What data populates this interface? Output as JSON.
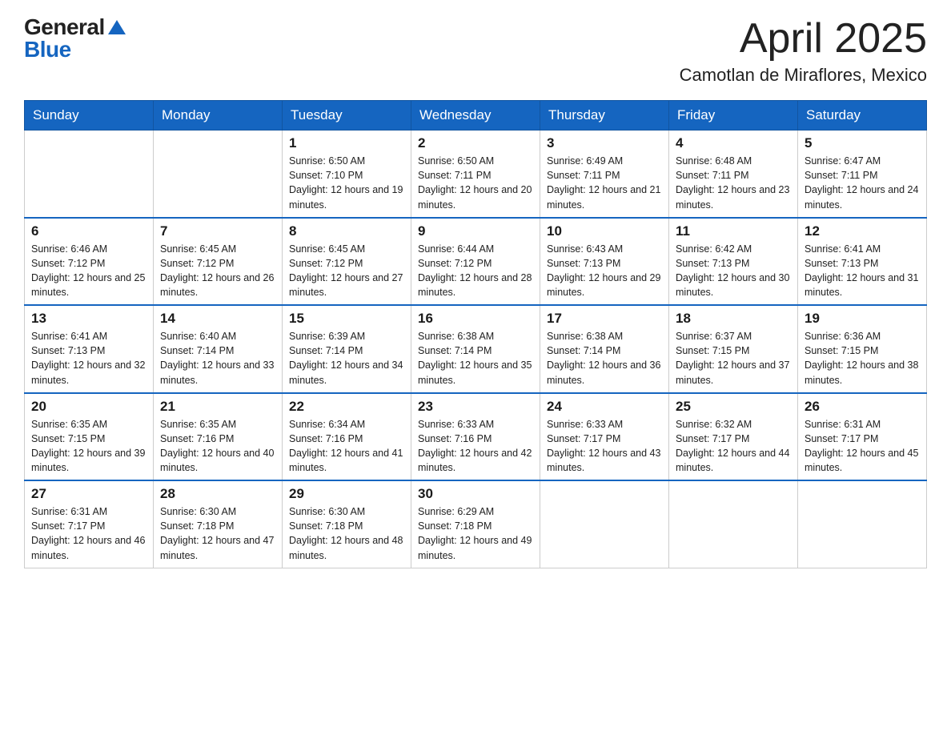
{
  "logo": {
    "general": "General",
    "blue": "Blue"
  },
  "title": "April 2025",
  "subtitle": "Camotlan de Miraflores, Mexico",
  "days_of_week": [
    "Sunday",
    "Monday",
    "Tuesday",
    "Wednesday",
    "Thursday",
    "Friday",
    "Saturday"
  ],
  "weeks": [
    [
      {
        "day": "",
        "sunrise": "",
        "sunset": "",
        "daylight": ""
      },
      {
        "day": "",
        "sunrise": "",
        "sunset": "",
        "daylight": ""
      },
      {
        "day": "1",
        "sunrise": "Sunrise: 6:50 AM",
        "sunset": "Sunset: 7:10 PM",
        "daylight": "Daylight: 12 hours and 19 minutes."
      },
      {
        "day": "2",
        "sunrise": "Sunrise: 6:50 AM",
        "sunset": "Sunset: 7:11 PM",
        "daylight": "Daylight: 12 hours and 20 minutes."
      },
      {
        "day": "3",
        "sunrise": "Sunrise: 6:49 AM",
        "sunset": "Sunset: 7:11 PM",
        "daylight": "Daylight: 12 hours and 21 minutes."
      },
      {
        "day": "4",
        "sunrise": "Sunrise: 6:48 AM",
        "sunset": "Sunset: 7:11 PM",
        "daylight": "Daylight: 12 hours and 23 minutes."
      },
      {
        "day": "5",
        "sunrise": "Sunrise: 6:47 AM",
        "sunset": "Sunset: 7:11 PM",
        "daylight": "Daylight: 12 hours and 24 minutes."
      }
    ],
    [
      {
        "day": "6",
        "sunrise": "Sunrise: 6:46 AM",
        "sunset": "Sunset: 7:12 PM",
        "daylight": "Daylight: 12 hours and 25 minutes."
      },
      {
        "day": "7",
        "sunrise": "Sunrise: 6:45 AM",
        "sunset": "Sunset: 7:12 PM",
        "daylight": "Daylight: 12 hours and 26 minutes."
      },
      {
        "day": "8",
        "sunrise": "Sunrise: 6:45 AM",
        "sunset": "Sunset: 7:12 PM",
        "daylight": "Daylight: 12 hours and 27 minutes."
      },
      {
        "day": "9",
        "sunrise": "Sunrise: 6:44 AM",
        "sunset": "Sunset: 7:12 PM",
        "daylight": "Daylight: 12 hours and 28 minutes."
      },
      {
        "day": "10",
        "sunrise": "Sunrise: 6:43 AM",
        "sunset": "Sunset: 7:13 PM",
        "daylight": "Daylight: 12 hours and 29 minutes."
      },
      {
        "day": "11",
        "sunrise": "Sunrise: 6:42 AM",
        "sunset": "Sunset: 7:13 PM",
        "daylight": "Daylight: 12 hours and 30 minutes."
      },
      {
        "day": "12",
        "sunrise": "Sunrise: 6:41 AM",
        "sunset": "Sunset: 7:13 PM",
        "daylight": "Daylight: 12 hours and 31 minutes."
      }
    ],
    [
      {
        "day": "13",
        "sunrise": "Sunrise: 6:41 AM",
        "sunset": "Sunset: 7:13 PM",
        "daylight": "Daylight: 12 hours and 32 minutes."
      },
      {
        "day": "14",
        "sunrise": "Sunrise: 6:40 AM",
        "sunset": "Sunset: 7:14 PM",
        "daylight": "Daylight: 12 hours and 33 minutes."
      },
      {
        "day": "15",
        "sunrise": "Sunrise: 6:39 AM",
        "sunset": "Sunset: 7:14 PM",
        "daylight": "Daylight: 12 hours and 34 minutes."
      },
      {
        "day": "16",
        "sunrise": "Sunrise: 6:38 AM",
        "sunset": "Sunset: 7:14 PM",
        "daylight": "Daylight: 12 hours and 35 minutes."
      },
      {
        "day": "17",
        "sunrise": "Sunrise: 6:38 AM",
        "sunset": "Sunset: 7:14 PM",
        "daylight": "Daylight: 12 hours and 36 minutes."
      },
      {
        "day": "18",
        "sunrise": "Sunrise: 6:37 AM",
        "sunset": "Sunset: 7:15 PM",
        "daylight": "Daylight: 12 hours and 37 minutes."
      },
      {
        "day": "19",
        "sunrise": "Sunrise: 6:36 AM",
        "sunset": "Sunset: 7:15 PM",
        "daylight": "Daylight: 12 hours and 38 minutes."
      }
    ],
    [
      {
        "day": "20",
        "sunrise": "Sunrise: 6:35 AM",
        "sunset": "Sunset: 7:15 PM",
        "daylight": "Daylight: 12 hours and 39 minutes."
      },
      {
        "day": "21",
        "sunrise": "Sunrise: 6:35 AM",
        "sunset": "Sunset: 7:16 PM",
        "daylight": "Daylight: 12 hours and 40 minutes."
      },
      {
        "day": "22",
        "sunrise": "Sunrise: 6:34 AM",
        "sunset": "Sunset: 7:16 PM",
        "daylight": "Daylight: 12 hours and 41 minutes."
      },
      {
        "day": "23",
        "sunrise": "Sunrise: 6:33 AM",
        "sunset": "Sunset: 7:16 PM",
        "daylight": "Daylight: 12 hours and 42 minutes."
      },
      {
        "day": "24",
        "sunrise": "Sunrise: 6:33 AM",
        "sunset": "Sunset: 7:17 PM",
        "daylight": "Daylight: 12 hours and 43 minutes."
      },
      {
        "day": "25",
        "sunrise": "Sunrise: 6:32 AM",
        "sunset": "Sunset: 7:17 PM",
        "daylight": "Daylight: 12 hours and 44 minutes."
      },
      {
        "day": "26",
        "sunrise": "Sunrise: 6:31 AM",
        "sunset": "Sunset: 7:17 PM",
        "daylight": "Daylight: 12 hours and 45 minutes."
      }
    ],
    [
      {
        "day": "27",
        "sunrise": "Sunrise: 6:31 AM",
        "sunset": "Sunset: 7:17 PM",
        "daylight": "Daylight: 12 hours and 46 minutes."
      },
      {
        "day": "28",
        "sunrise": "Sunrise: 6:30 AM",
        "sunset": "Sunset: 7:18 PM",
        "daylight": "Daylight: 12 hours and 47 minutes."
      },
      {
        "day": "29",
        "sunrise": "Sunrise: 6:30 AM",
        "sunset": "Sunset: 7:18 PM",
        "daylight": "Daylight: 12 hours and 48 minutes."
      },
      {
        "day": "30",
        "sunrise": "Sunrise: 6:29 AM",
        "sunset": "Sunset: 7:18 PM",
        "daylight": "Daylight: 12 hours and 49 minutes."
      },
      {
        "day": "",
        "sunrise": "",
        "sunset": "",
        "daylight": ""
      },
      {
        "day": "",
        "sunrise": "",
        "sunset": "",
        "daylight": ""
      },
      {
        "day": "",
        "sunrise": "",
        "sunset": "",
        "daylight": ""
      }
    ]
  ]
}
